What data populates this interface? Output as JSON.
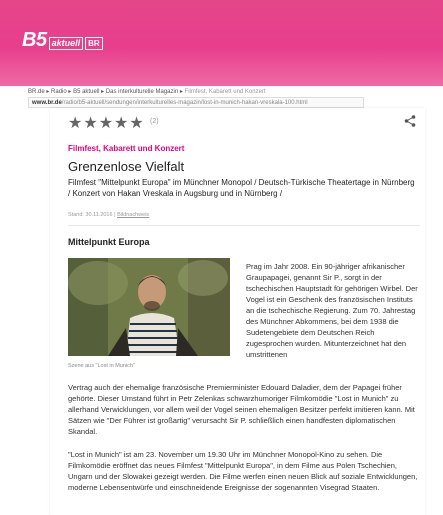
{
  "logo": {
    "b5": "B5",
    "aktuell": "aktuell",
    "br": "BR"
  },
  "breadcrumb": {
    "items": [
      "BR.de",
      "Radio",
      "B5 aktuell",
      "Das interkulturelle Magazin"
    ],
    "current": "Filmfest, Kabarett und Konzert",
    "separator": "▸"
  },
  "url": {
    "domain": "www.br.de",
    "path": "/radio/b5-aktuell/sendungen/interkulturelles-magazin/lost-in-munich-hakan-vreskala-100.html"
  },
  "rating": {
    "stars": "★★★★★",
    "count": "(2)"
  },
  "share_icon": "share-icon",
  "article": {
    "kicker": "Filmfest, Kabarett und Konzert",
    "title": "Grenzenlose Vielfalt",
    "lead": "Filmfest \"Mittelpunkt Europa\" im Münchner Monopol / Deutsch-Türkische Theatertage in Nürnberg / Konzert von Hakan Vreskala in Augsburg und in Nürnberg /",
    "meta_stand": "Stand: 30.11.2016",
    "meta_sep": " | ",
    "meta_link": "Bildnachweis",
    "section_title": "Mittelpunkt Europa",
    "caption": "Szene aus \"Lost in Munich\"",
    "para_right": "Prag im Jahr 2008. Ein 90-jähriger afrikanischer Graupapagei, genannt Sir P., sorgt in der tschechischen Hauptstadt für gehörigen Wirbel. Der Vogel ist ein Geschenk des französischen Instituts an die tschechische Regierung. Zum 70. Jahrestag des Münchner Abkommens, bei dem 1938 die Sudetengebiete dem Deutschen Reich zugesprochen wurden. Mitunterzeichnet hat den umstrittenen",
    "para_full_1": "Vertrag auch der ehemalige französische Premierminister Edouard Daladier, dem der Papagei früher gehörte. Dieser Umstand führt in Petr Zelenkas schwarzhumoriger Filmkomödie \"Lost in Munich\" zu allerhand Verwicklungen, vor allem weil der Vogel seinen ehemaligen Besitzer perfekt imitieren kann. Mit Sätzen wie \"Der Führer ist großartig\" verursacht Sir P. schließlich einen handfesten diplomatischen Skandal.",
    "para_full_2": "\"Lost in Munich\" ist am 23. November um 19.30 Uhr im Münchner Monopol-Kino zu sehen. Die Filmkomödie eröffnet das neues Filmfest \"Mittelpunkt Europa\", in dem Filme aus Polen Tschechien, Ungarn und der Slowakei gezeigt werden. Die Filme werfen einen neuen Blick auf soziale Entwicklungen, moderne Lebensentwürfe und einschneidende Ereignisse der sogenannten Visegrad Staaten."
  },
  "colors": {
    "brand_pink": "#e83e8c",
    "kicker": "#e2007a"
  }
}
